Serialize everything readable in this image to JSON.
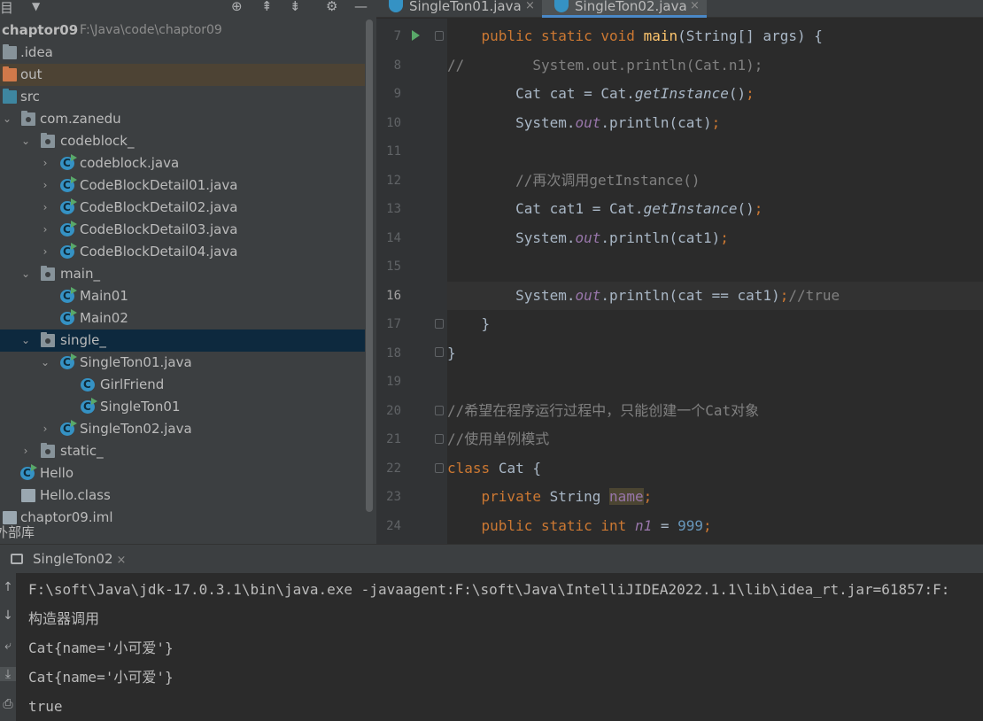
{
  "project_panel": {
    "toolbar": {
      "title_fragment": "目",
      "icons": [
        "chevron-down-icon",
        "target-icon",
        "expand-all-icon",
        "collapse-all-icon",
        "gear-icon",
        "minimize-icon"
      ]
    },
    "tree": [
      {
        "label": "chaptor09",
        "hint": "F:\\Java\\code\\chaptor09",
        "icon": "folder"
      },
      {
        "label": ".idea",
        "icon": "folder"
      },
      {
        "label": "out",
        "icon": "folder-orange"
      },
      {
        "label": "src",
        "icon": "folder-blue"
      },
      {
        "label": "com.zanedu",
        "icon": "package"
      },
      {
        "label": "codeblock_",
        "icon": "package"
      },
      {
        "label": "codeblock.java",
        "icon": "class-run"
      },
      {
        "label": "CodeBlockDetail01.java",
        "icon": "class-run"
      },
      {
        "label": "CodeBlockDetail02.java",
        "icon": "class-run"
      },
      {
        "label": "CodeBlockDetail03.java",
        "icon": "class-run"
      },
      {
        "label": "CodeBlockDetail04.java",
        "icon": "class-run"
      },
      {
        "label": "main_",
        "icon": "package"
      },
      {
        "label": "Main01",
        "icon": "class-run"
      },
      {
        "label": "Main02",
        "icon": "class-run"
      },
      {
        "label": "single_",
        "icon": "package"
      },
      {
        "label": "SingleTon01.java",
        "icon": "class-run"
      },
      {
        "label": "GirlFriend",
        "icon": "class"
      },
      {
        "label": "SingleTon01",
        "icon": "class-run"
      },
      {
        "label": "SingleTon02.java",
        "icon": "class-run"
      },
      {
        "label": "static_",
        "icon": "package"
      },
      {
        "label": "Hello",
        "icon": "class-run"
      },
      {
        "label": "Hello.class",
        "icon": "file"
      },
      {
        "label": "chaptor09.iml",
        "icon": "file"
      },
      {
        "label": "外部库",
        "icon": "library"
      }
    ]
  },
  "editor": {
    "tabs": [
      {
        "label": "SingleTon01.java",
        "close": "×",
        "active": false
      },
      {
        "label": "SingleTon02.java",
        "close": "×",
        "active": true
      }
    ],
    "line_numbers": [
      "7",
      "8",
      "9",
      "10",
      "11",
      "12",
      "13",
      "14",
      "15",
      "16",
      "17",
      "18",
      "19",
      "20",
      "21",
      "22",
      "23",
      "24"
    ],
    "current_line": "16",
    "code": {
      "l7": [
        "public",
        "static",
        "void",
        "main",
        "(String[] args) {"
      ],
      "l8": [
        "//",
        "System.out.println(Cat.n1);"
      ],
      "l9": [
        "Cat cat = Cat.",
        "getInstance",
        "()",
        ";"
      ],
      "l10": [
        "System.",
        "out",
        ".println(cat)",
        ";"
      ],
      "l12": "//再次调用getInstance()",
      "l13": [
        "Cat cat1 = Cat.",
        "getInstance",
        "()",
        ";"
      ],
      "l14": [
        "System.",
        "out",
        ".println(cat1)",
        ";"
      ],
      "l16": [
        "System.",
        "out",
        ".println(cat == cat1)",
        ";",
        "//true"
      ],
      "l17": "}",
      "l18": "}",
      "l20": "//希望在程序运行过程中，只能创建一个Cat对象",
      "l21": "//使用单例模式",
      "l22": [
        "class",
        "Cat {"
      ],
      "l23": [
        "private",
        "String",
        "name",
        ";"
      ],
      "l24": [
        "public",
        "static",
        "int",
        "n1",
        "=",
        "999",
        ";"
      ]
    }
  },
  "run_panel": {
    "tab_label": "SingleTon02",
    "tab_close": "×",
    "console_lines": [
      "F:\\soft\\Java\\jdk-17.0.3.1\\bin\\java.exe -javaagent:F:\\soft\\Java\\IntelliJIDEA2022.1.1\\lib\\idea_rt.jar=61857:F:",
      "构造器调用",
      "Cat{name='小可爱'}",
      "Cat{name='小可爱'}",
      "true"
    ],
    "side_icons": [
      "rerun-icon",
      "scroll-down-icon",
      "soft-wrap-icon",
      "scroll-to-end-icon",
      "print-icon"
    ]
  },
  "colors": {
    "panel_bg": "#3c3f41",
    "editor_bg": "#2b2b2b",
    "keyword": "#cc7832",
    "function": "#ffc66d",
    "static_field": "#9876aa",
    "comment": "#808080",
    "number": "#6897bb",
    "selection": "#0d293e",
    "excluded_folder": "#4d4334"
  }
}
